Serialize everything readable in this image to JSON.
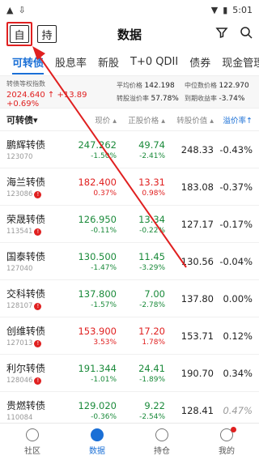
{
  "status": {
    "time": "5:01"
  },
  "titlebar": {
    "btn_self": "自",
    "btn_hold": "持",
    "title": "数据"
  },
  "tabs": [
    "可转债",
    "股息率",
    "新股",
    "T+0 QDII",
    "债券",
    "现金管理"
  ],
  "index_panel": {
    "label": "转债等权指数",
    "value": "2024.640 ↑ +13.89 +0.69%",
    "avg_price_label": "平均价格",
    "avg_price": "142.198",
    "median_label": "中位数价格",
    "median": "122.970",
    "stock_prem_label": "转股溢价率",
    "stock_prem": "57.78%",
    "ytm_label": "到期收益率",
    "ytm": "-3.74%"
  },
  "columns": {
    "name": "可转债",
    "price": "现价",
    "stock": "正股价格",
    "value": "转股价值",
    "prem": "溢价率"
  },
  "rows": [
    {
      "name": "鹏辉转债",
      "code": "123070",
      "alert": false,
      "price": "247.262",
      "price_pct": "-1.50%",
      "price_dir": "down",
      "stock": "49.74",
      "stock_pct": "-2.41%",
      "stock_dir": "down",
      "value": "248.33",
      "prem": "-0.43%"
    },
    {
      "name": "海兰转债",
      "code": "123086",
      "alert": true,
      "price": "182.400",
      "price_pct": "0.37%",
      "price_dir": "up",
      "stock": "13.31",
      "stock_pct": "0.98%",
      "stock_dir": "up",
      "value": "183.08",
      "prem": "-0.37%"
    },
    {
      "name": "荣晟转债",
      "code": "113541",
      "alert": true,
      "price": "126.950",
      "price_pct": "-0.11%",
      "price_dir": "down",
      "stock": "13.34",
      "stock_pct": "-0.22%",
      "stock_dir": "down",
      "value": "127.17",
      "prem": "-0.17%"
    },
    {
      "name": "国泰转债",
      "code": "127040",
      "alert": false,
      "price": "130.500",
      "price_pct": "-1.47%",
      "price_dir": "down",
      "stock": "11.45",
      "stock_pct": "-3.29%",
      "stock_dir": "down",
      "value": "130.56",
      "prem": "-0.04%"
    },
    {
      "name": "交科转债",
      "code": "128107",
      "alert": true,
      "price": "137.800",
      "price_pct": "-1.57%",
      "price_dir": "down",
      "stock": "7.00",
      "stock_pct": "-2.78%",
      "stock_dir": "down",
      "value": "137.80",
      "prem": "0.00%"
    },
    {
      "name": "创维转债",
      "code": "127013",
      "alert": true,
      "price": "153.900",
      "price_pct": "3.53%",
      "price_dir": "up",
      "stock": "17.20",
      "stock_pct": "1.78%",
      "stock_dir": "up",
      "value": "153.71",
      "prem": "0.12%"
    },
    {
      "name": "利尔转债",
      "code": "128046",
      "alert": true,
      "price": "191.344",
      "price_pct": "-1.01%",
      "price_dir": "down",
      "stock": "24.41",
      "stock_pct": "-1.89%",
      "stock_dir": "down",
      "value": "190.70",
      "prem": "0.34%"
    },
    {
      "name": "贵燃转债",
      "code": "110084",
      "alert": false,
      "price": "129.020",
      "price_pct": "-0.36%",
      "price_dir": "down",
      "stock": "9.22",
      "stock_pct": "-2.54%",
      "stock_dir": "down",
      "value": "128.41",
      "prem": "0.47%",
      "muted": true
    }
  ],
  "nav": [
    "社区",
    "数据",
    "持仓",
    "我的"
  ],
  "colors": {
    "accent": "#1a6fd6",
    "up": "#e02020",
    "down": "#1a8a3a",
    "annotation": "#e02020"
  }
}
